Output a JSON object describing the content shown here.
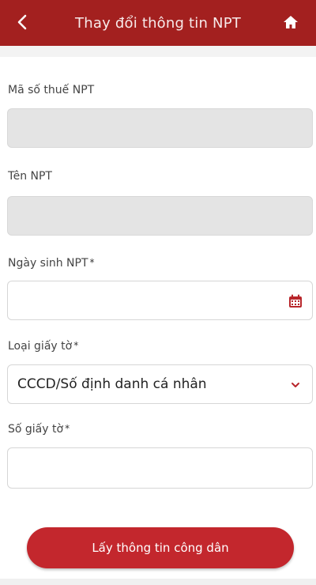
{
  "header": {
    "title": "Thay đổi thông tin NPT"
  },
  "form": {
    "tax_code_label": "Mã số thuế NPT",
    "tax_code_value": "",
    "name_label": "Tên NPT",
    "name_value": "",
    "dob_label": "Ngày sinh NPT",
    "dob_value": "",
    "doc_type_label": "Loại giấy tờ",
    "doc_type_value": "CCCD/Số định danh cá nhân",
    "doc_number_label": "Số giấy tờ",
    "doc_number_value": "",
    "required_mark": "*"
  },
  "actions": {
    "fetch_button": "Lấy thông tin công dân"
  },
  "colors": {
    "header_bg": "#a3201f",
    "button_bg": "#c3272d",
    "calendar_icon": "#b8262b"
  },
  "icons": [
    "back-icon",
    "home-icon",
    "calendar-icon",
    "chevron-down-icon"
  ]
}
